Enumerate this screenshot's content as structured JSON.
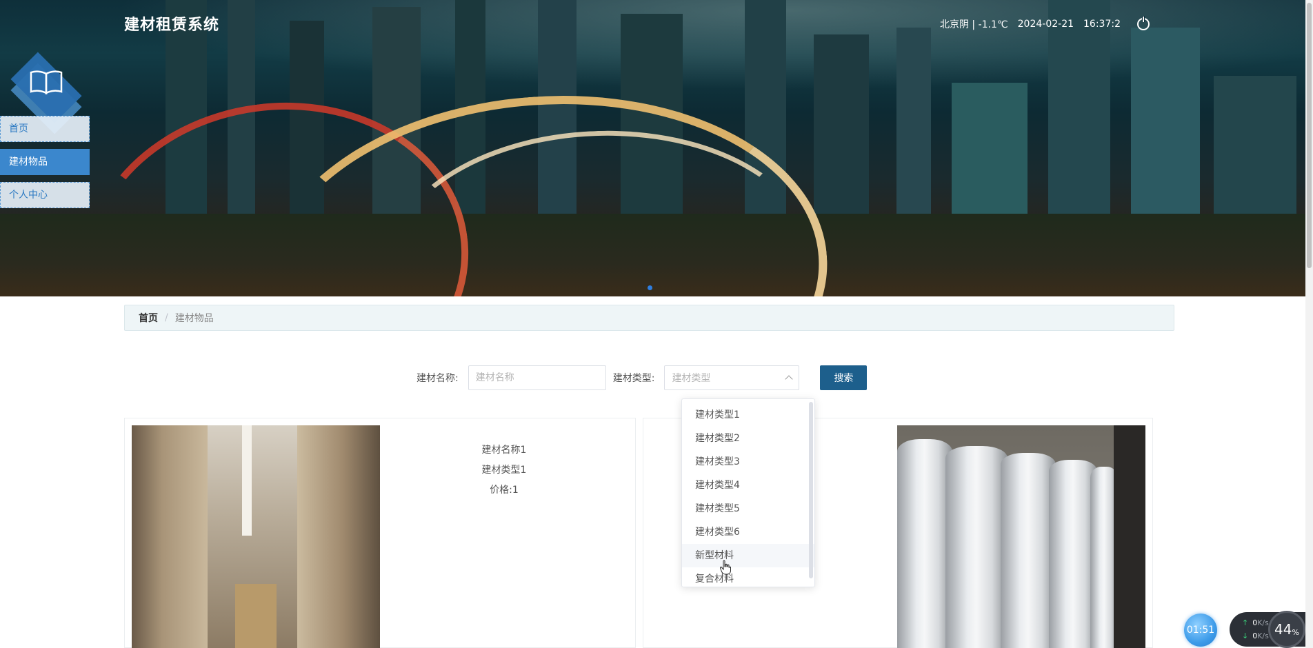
{
  "header": {
    "title": "建材租赁系统",
    "weather": "北京阴 | -1.1℃",
    "date": "2024-02-21",
    "time": "16:37:2"
  },
  "sidebar": {
    "items": [
      {
        "label": "首页",
        "state": "light"
      },
      {
        "label": "建材物品",
        "state": "active"
      },
      {
        "label": "个人中心",
        "state": "light"
      }
    ]
  },
  "breadcrumb": {
    "home": "首页",
    "separator": "/",
    "current": "建材物品"
  },
  "search": {
    "name_label": "建材名称:",
    "name_placeholder": "建材名称",
    "type_label": "建材类型:",
    "type_placeholder": "建材类型",
    "button": "搜索"
  },
  "dropdown": {
    "options": [
      "建材类型1",
      "建材类型2",
      "建材类型3",
      "建材类型4",
      "建材类型5",
      "建材类型6",
      "新型材料",
      "复合材料"
    ],
    "hovered_index": 6
  },
  "cards": [
    {
      "name": "建材名称1",
      "type": "建材类型1",
      "price": "价格:1",
      "image": "warehouse-aisle"
    },
    {
      "image": "insulation-rolls"
    }
  ],
  "widgets": {
    "timer": "01:51",
    "net_up": "0",
    "net_down": "0",
    "net_unit": "K/s",
    "net_percent": "44",
    "percent_sign": "%"
  },
  "colors": {
    "accent": "#1d5f8c",
    "sidebar_active": "#3b87cd",
    "sidebar_light_text": "#2b79c2"
  }
}
